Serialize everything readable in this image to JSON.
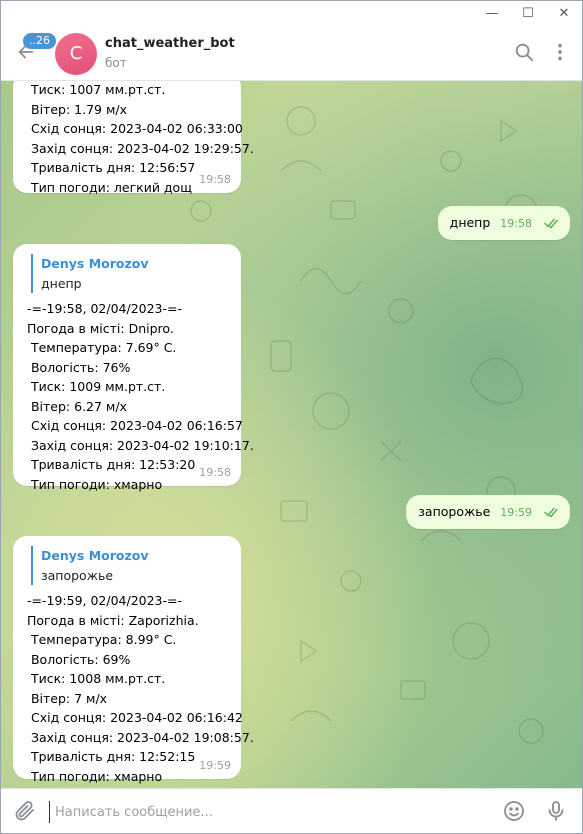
{
  "window": {
    "controls": {
      "minimize": "—",
      "maximize": "☐",
      "close": "✕"
    }
  },
  "header": {
    "unread_badge": "..26",
    "avatar_letter": "C",
    "title": "chat_weather_bot",
    "subtitle": "бот"
  },
  "messages": [
    {
      "type": "incoming",
      "lines": [
        "Тиск: 1007 мм.рт.ст.",
        "Вітер: 1.79 м/х",
        "Схід сонця: 2023-04-02 06:33:00",
        "Захід сонця: 2023-04-02 19:29:57.",
        "Тривалість дня: 12:56:57",
        "Тип погоди: легкий дощ"
      ],
      "time": "19:58"
    },
    {
      "type": "outgoing",
      "text": "днепр",
      "time": "19:58"
    },
    {
      "type": "incoming",
      "reply_name": "Denys Morozov",
      "reply_text": "днепр",
      "lines": [
        "-=-19:58, 02/04/2023-=-",
        "Погода в місті: Dnipro.",
        " Температура: 7.69° C.",
        " Вологість: 76%",
        " Тиск: 1009 мм.рт.ст.",
        " Вітер: 6.27 м/х",
        " Схід сонця: 2023-04-02 06:16:57",
        " Захід сонця: 2023-04-02 19:10:17.",
        " Тривалість дня: 12:53:20",
        " Тип погоди: хмарно"
      ],
      "time": "19:58"
    },
    {
      "type": "outgoing",
      "text": "запорожье",
      "time": "19:59"
    },
    {
      "type": "incoming",
      "reply_name": "Denys Morozov",
      "reply_text": "запорожье",
      "lines": [
        "-=-19:59, 02/04/2023-=-",
        "Погода в місті: Zaporizhia.",
        " Температура: 8.99° C.",
        " Вологість: 69%",
        " Тиск: 1008 мм.рт.ст.",
        " Вітер: 7 м/х",
        " Схід сонця: 2023-04-02 06:16:42",
        " Захід сонця: 2023-04-02 19:08:57.",
        " Тривалість дня: 12:52:15",
        " Тип погоди: хмарно"
      ],
      "time": "19:59"
    }
  ],
  "composer": {
    "placeholder": "Написать сообщение..."
  },
  "colors": {
    "accent": "#3a8fd5",
    "outgoing_bubble": "#effdde",
    "read_check": "#5eb05a",
    "avatar": "#e25078"
  },
  "icons": {
    "back": "arrow-left-icon",
    "search": "search-icon",
    "menu": "more-vertical-icon",
    "attach": "paperclip-icon",
    "emoji": "smile-icon",
    "mic": "microphone-icon",
    "read": "double-check-icon"
  }
}
